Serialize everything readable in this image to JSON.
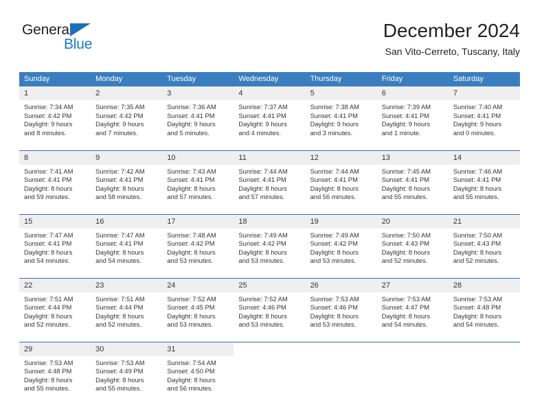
{
  "brand": {
    "name_dark": "General",
    "name_blue": "Blue",
    "accent_color": "#1878c4",
    "header_color": "#3a7ebf",
    "separator_color": "#2f6fae",
    "daynum_band_color": "#efefef"
  },
  "header": {
    "title": "December 2024",
    "subtitle": "San Vito-Cerreto, Tuscany, Italy"
  },
  "weekdays": [
    "Sunday",
    "Monday",
    "Tuesday",
    "Wednesday",
    "Thursday",
    "Friday",
    "Saturday"
  ],
  "weeks": [
    [
      {
        "day": "1",
        "sunrise": "Sunrise: 7:34 AM",
        "sunset": "Sunset: 4:42 PM",
        "daylight1": "Daylight: 9 hours",
        "daylight2": "and 8 minutes."
      },
      {
        "day": "2",
        "sunrise": "Sunrise: 7:35 AM",
        "sunset": "Sunset: 4:42 PM",
        "daylight1": "Daylight: 9 hours",
        "daylight2": "and 7 minutes."
      },
      {
        "day": "3",
        "sunrise": "Sunrise: 7:36 AM",
        "sunset": "Sunset: 4:41 PM",
        "daylight1": "Daylight: 9 hours",
        "daylight2": "and 5 minutes."
      },
      {
        "day": "4",
        "sunrise": "Sunrise: 7:37 AM",
        "sunset": "Sunset: 4:41 PM",
        "daylight1": "Daylight: 9 hours",
        "daylight2": "and 4 minutes."
      },
      {
        "day": "5",
        "sunrise": "Sunrise: 7:38 AM",
        "sunset": "Sunset: 4:41 PM",
        "daylight1": "Daylight: 9 hours",
        "daylight2": "and 3 minutes."
      },
      {
        "day": "6",
        "sunrise": "Sunrise: 7:39 AM",
        "sunset": "Sunset: 4:41 PM",
        "daylight1": "Daylight: 9 hours",
        "daylight2": "and 1 minute."
      },
      {
        "day": "7",
        "sunrise": "Sunrise: 7:40 AM",
        "sunset": "Sunset: 4:41 PM",
        "daylight1": "Daylight: 9 hours",
        "daylight2": "and 0 minutes."
      }
    ],
    [
      {
        "day": "8",
        "sunrise": "Sunrise: 7:41 AM",
        "sunset": "Sunset: 4:41 PM",
        "daylight1": "Daylight: 8 hours",
        "daylight2": "and 59 minutes."
      },
      {
        "day": "9",
        "sunrise": "Sunrise: 7:42 AM",
        "sunset": "Sunset: 4:41 PM",
        "daylight1": "Daylight: 8 hours",
        "daylight2": "and 58 minutes."
      },
      {
        "day": "10",
        "sunrise": "Sunrise: 7:43 AM",
        "sunset": "Sunset: 4:41 PM",
        "daylight1": "Daylight: 8 hours",
        "daylight2": "and 57 minutes."
      },
      {
        "day": "11",
        "sunrise": "Sunrise: 7:44 AM",
        "sunset": "Sunset: 4:41 PM",
        "daylight1": "Daylight: 8 hours",
        "daylight2": "and 57 minutes."
      },
      {
        "day": "12",
        "sunrise": "Sunrise: 7:44 AM",
        "sunset": "Sunset: 4:41 PM",
        "daylight1": "Daylight: 8 hours",
        "daylight2": "and 56 minutes."
      },
      {
        "day": "13",
        "sunrise": "Sunrise: 7:45 AM",
        "sunset": "Sunset: 4:41 PM",
        "daylight1": "Daylight: 8 hours",
        "daylight2": "and 55 minutes."
      },
      {
        "day": "14",
        "sunrise": "Sunrise: 7:46 AM",
        "sunset": "Sunset: 4:41 PM",
        "daylight1": "Daylight: 8 hours",
        "daylight2": "and 55 minutes."
      }
    ],
    [
      {
        "day": "15",
        "sunrise": "Sunrise: 7:47 AM",
        "sunset": "Sunset: 4:41 PM",
        "daylight1": "Daylight: 8 hours",
        "daylight2": "and 54 minutes."
      },
      {
        "day": "16",
        "sunrise": "Sunrise: 7:47 AM",
        "sunset": "Sunset: 4:41 PM",
        "daylight1": "Daylight: 8 hours",
        "daylight2": "and 54 minutes."
      },
      {
        "day": "17",
        "sunrise": "Sunrise: 7:48 AM",
        "sunset": "Sunset: 4:42 PM",
        "daylight1": "Daylight: 8 hours",
        "daylight2": "and 53 minutes."
      },
      {
        "day": "18",
        "sunrise": "Sunrise: 7:49 AM",
        "sunset": "Sunset: 4:42 PM",
        "daylight1": "Daylight: 8 hours",
        "daylight2": "and 53 minutes."
      },
      {
        "day": "19",
        "sunrise": "Sunrise: 7:49 AM",
        "sunset": "Sunset: 4:42 PM",
        "daylight1": "Daylight: 8 hours",
        "daylight2": "and 53 minutes."
      },
      {
        "day": "20",
        "sunrise": "Sunrise: 7:50 AM",
        "sunset": "Sunset: 4:43 PM",
        "daylight1": "Daylight: 8 hours",
        "daylight2": "and 52 minutes."
      },
      {
        "day": "21",
        "sunrise": "Sunrise: 7:50 AM",
        "sunset": "Sunset: 4:43 PM",
        "daylight1": "Daylight: 8 hours",
        "daylight2": "and 52 minutes."
      }
    ],
    [
      {
        "day": "22",
        "sunrise": "Sunrise: 7:51 AM",
        "sunset": "Sunset: 4:44 PM",
        "daylight1": "Daylight: 8 hours",
        "daylight2": "and 52 minutes."
      },
      {
        "day": "23",
        "sunrise": "Sunrise: 7:51 AM",
        "sunset": "Sunset: 4:44 PM",
        "daylight1": "Daylight: 8 hours",
        "daylight2": "and 52 minutes."
      },
      {
        "day": "24",
        "sunrise": "Sunrise: 7:52 AM",
        "sunset": "Sunset: 4:45 PM",
        "daylight1": "Daylight: 8 hours",
        "daylight2": "and 53 minutes."
      },
      {
        "day": "25",
        "sunrise": "Sunrise: 7:52 AM",
        "sunset": "Sunset: 4:46 PM",
        "daylight1": "Daylight: 8 hours",
        "daylight2": "and 53 minutes."
      },
      {
        "day": "26",
        "sunrise": "Sunrise: 7:53 AM",
        "sunset": "Sunset: 4:46 PM",
        "daylight1": "Daylight: 8 hours",
        "daylight2": "and 53 minutes."
      },
      {
        "day": "27",
        "sunrise": "Sunrise: 7:53 AM",
        "sunset": "Sunset: 4:47 PM",
        "daylight1": "Daylight: 8 hours",
        "daylight2": "and 54 minutes."
      },
      {
        "day": "28",
        "sunrise": "Sunrise: 7:53 AM",
        "sunset": "Sunset: 4:48 PM",
        "daylight1": "Daylight: 8 hours",
        "daylight2": "and 54 minutes."
      }
    ],
    [
      {
        "day": "29",
        "sunrise": "Sunrise: 7:53 AM",
        "sunset": "Sunset: 4:48 PM",
        "daylight1": "Daylight: 8 hours",
        "daylight2": "and 55 minutes."
      },
      {
        "day": "30",
        "sunrise": "Sunrise: 7:53 AM",
        "sunset": "Sunset: 4:49 PM",
        "daylight1": "Daylight: 8 hours",
        "daylight2": "and 55 minutes."
      },
      {
        "day": "31",
        "sunrise": "Sunrise: 7:54 AM",
        "sunset": "Sunset: 4:50 PM",
        "daylight1": "Daylight: 8 hours",
        "daylight2": "and 56 minutes."
      },
      {
        "day": "",
        "sunrise": "",
        "sunset": "",
        "daylight1": "",
        "daylight2": ""
      },
      {
        "day": "",
        "sunrise": "",
        "sunset": "",
        "daylight1": "",
        "daylight2": ""
      },
      {
        "day": "",
        "sunrise": "",
        "sunset": "",
        "daylight1": "",
        "daylight2": ""
      },
      {
        "day": "",
        "sunrise": "",
        "sunset": "",
        "daylight1": "",
        "daylight2": ""
      }
    ]
  ]
}
